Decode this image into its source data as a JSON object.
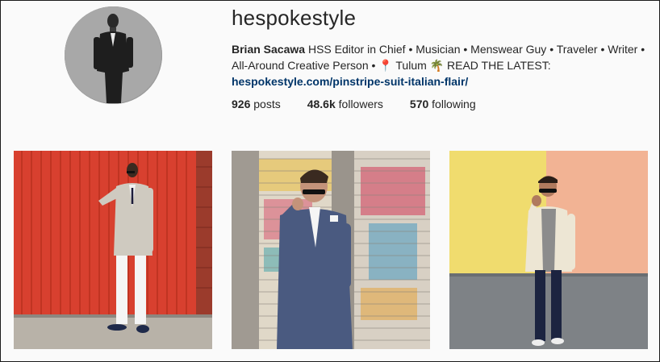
{
  "profile": {
    "username": "hespokestyle",
    "full_name": "Brian Sacawa",
    "bio_line1": " HSS Editor in Chief • Musician • Menswear Guy • Traveler • Writer • All-Around Creative Person • ",
    "bio_pin_icon": "pin-icon",
    "bio_location": " Tulum ",
    "bio_palm_icon": "palm-tree-icon",
    "bio_tail": " READ THE LATEST:",
    "link": "hespokestyle.com/pinstripe-suit-italian-flair/"
  },
  "stats": {
    "posts_count": "926",
    "posts_label": " posts",
    "followers_count": "48.6k",
    "followers_label": " followers",
    "following_count": "570",
    "following_label": " following"
  },
  "colors": {
    "link": "#003569",
    "red_wall": "#d8402f",
    "yellow_wall": "#f0dc6e",
    "peach_wall": "#f2b394"
  },
  "posts": [
    {
      "alt_icon": "photo-man-light-suit-red-wall"
    },
    {
      "alt_icon": "photo-man-blue-suit-graffiti"
    },
    {
      "alt_icon": "photo-man-cream-blazer-yellow-wall"
    }
  ]
}
